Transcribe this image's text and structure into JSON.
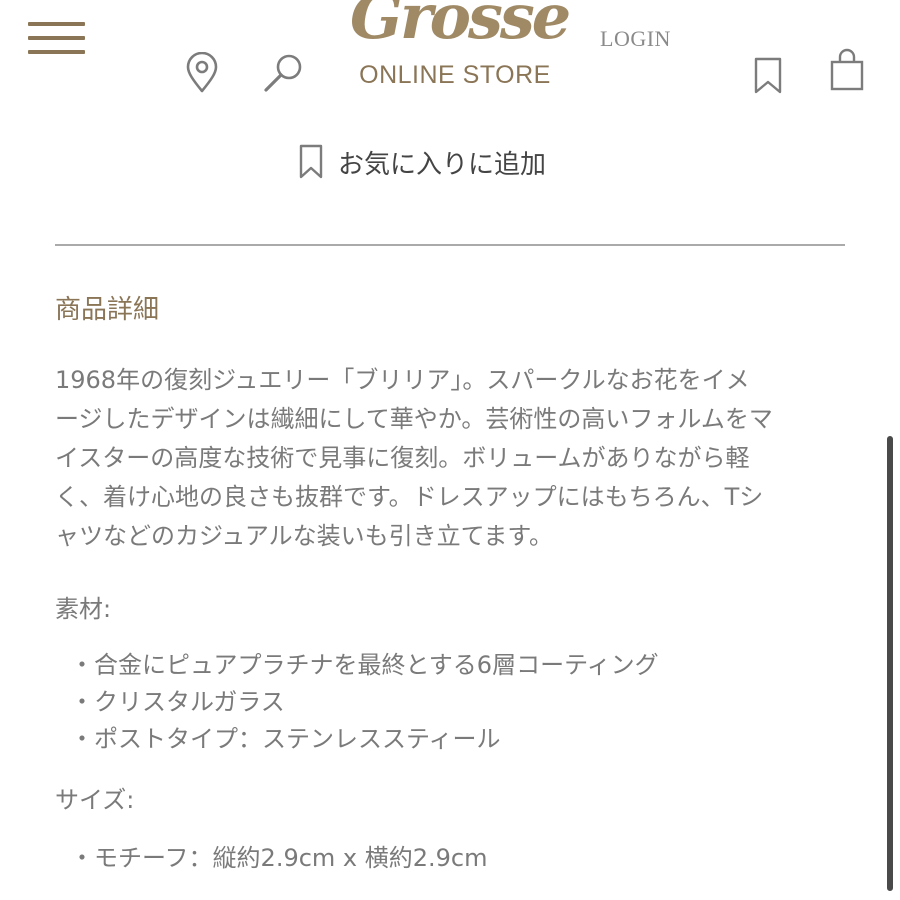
{
  "header": {
    "logo_script": "Grossé",
    "logo_sub": "ONLINE STORE",
    "login_label": "LOGIN",
    "icons": [
      "menu-icon",
      "location-pin-icon",
      "search-icon",
      "bookmark-icon",
      "shopping-bag-icon"
    ]
  },
  "favorite": {
    "label": "お気に入りに追加"
  },
  "detail": {
    "title": "商品詳細",
    "description_lines": [
      "1968年の復刻ジュエリー「ブリリア」。スパークルなお花をイメ",
      "ージしたデザインは繊細にして華やか。芸術性の高いフォルムをマ",
      "イスターの高度な技術で見事に復刻。ボリュームがありながら軽",
      "く、着け心地の良さも抜群です。ドレスアップにはもちろん、Tシ",
      "ャツなどのカジュアルな装いも引き立てます。"
    ],
    "material_label": "素材:",
    "materials": [
      "合金にピュアプラチナを最終とする6層コーティング",
      "クリスタルガラス",
      "ポストタイプ：ステンレススティール"
    ],
    "size_label": "サイズ:",
    "sizes": [
      "モチーフ：縦約2.9cm x 横約2.9cm"
    ]
  },
  "colors": {
    "brand": "#8a7556",
    "text": "#7a7a7a",
    "divider": "#aaaaaa"
  }
}
